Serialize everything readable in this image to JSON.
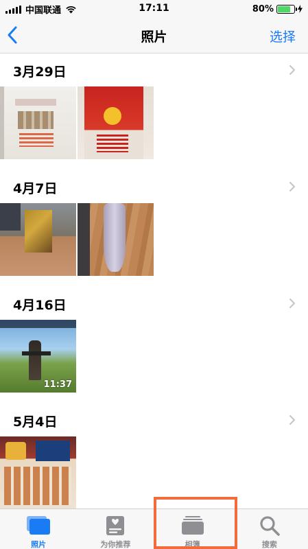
{
  "status_bar": {
    "carrier": "中国联通",
    "time": "17:11",
    "battery_percent": "80%",
    "battery_level": 0.8
  },
  "nav": {
    "back_icon": "chevron-left-icon",
    "title": "照片",
    "select_label": "选择"
  },
  "sections": [
    {
      "date": "3月29日",
      "thumbnails": [
        {
          "kind": "photo"
        },
        {
          "kind": "photo"
        }
      ]
    },
    {
      "date": "4月7日",
      "thumbnails": [
        {
          "kind": "photo"
        },
        {
          "kind": "photo"
        }
      ]
    },
    {
      "date": "4月16日",
      "thumbnails": [
        {
          "kind": "video",
          "duration": "11:37"
        }
      ]
    },
    {
      "date": "5月4日",
      "thumbnails": [
        {
          "kind": "photo"
        }
      ]
    }
  ],
  "tabs": [
    {
      "label": "照片",
      "icon": "photos-icon",
      "active": true
    },
    {
      "label": "为你推荐",
      "icon": "for-you-icon",
      "active": false
    },
    {
      "label": "相簿",
      "icon": "albums-icon",
      "active": false
    },
    {
      "label": "搜索",
      "icon": "search-icon",
      "active": false
    }
  ],
  "colors": {
    "accent": "#1a7cf5",
    "highlight": "#f26b3a",
    "battery": "#4cd964"
  }
}
